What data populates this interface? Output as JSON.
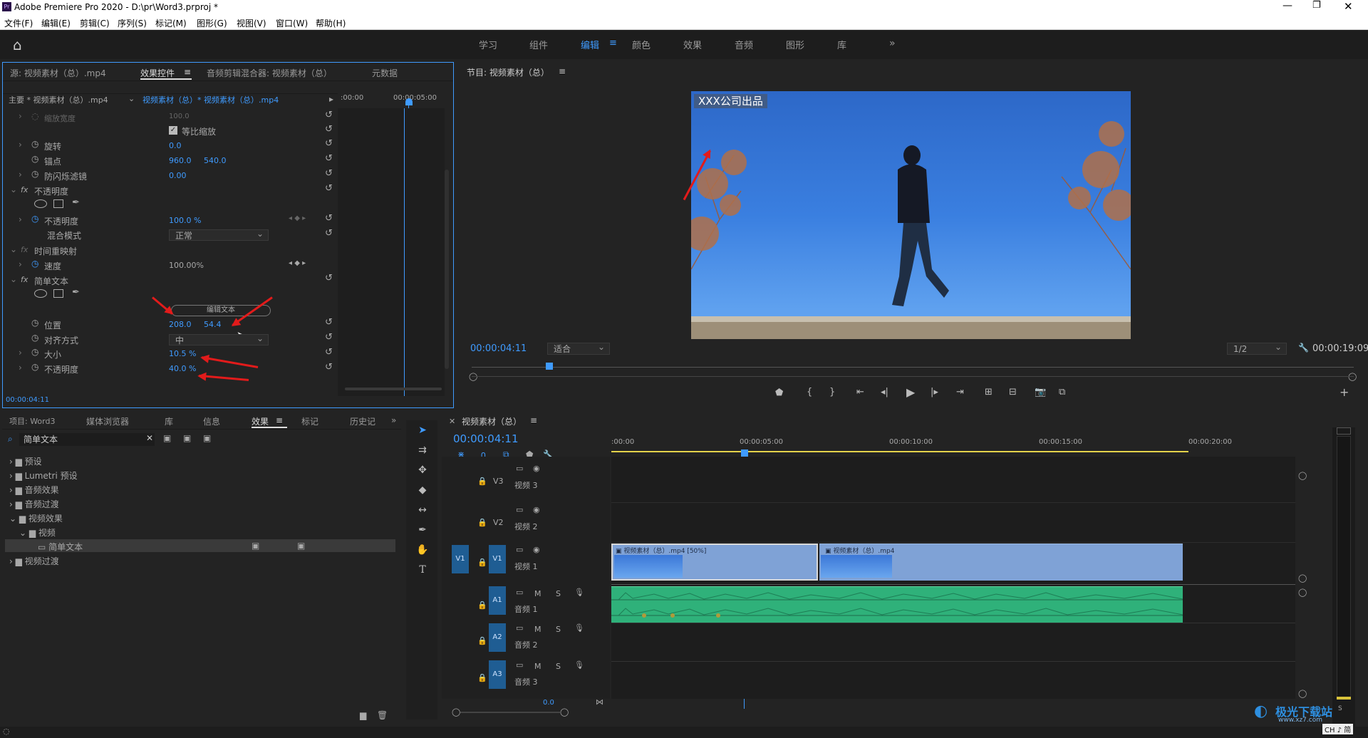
{
  "window": {
    "title": "Adobe Premiere Pro 2020 - D:\\pr\\Word3.prproj *",
    "app_icon": "Pr"
  },
  "menu": [
    "文件(F)",
    "编辑(E)",
    "剪辑(C)",
    "序列(S)",
    "标记(M)",
    "图形(G)",
    "视图(V)",
    "窗口(W)",
    "帮助(H)"
  ],
  "workspaces": [
    "学习",
    "组件",
    "编辑",
    "颜色",
    "效果",
    "音频",
    "图形",
    "库"
  ],
  "active_workspace": "编辑",
  "source_tabs": [
    "源: 视频素材（总）.mp4",
    "效果控件",
    "音频剪辑混合器: 视频素材（总）",
    "元数据"
  ],
  "effect_controls": {
    "master_label": "主要 * 视频素材（总）.mp4",
    "clip_label": "视频素材（总）* 视频素材（总）.mp4",
    "time0": ":00:00",
    "time1": "00:00:05:00",
    "rows": {
      "scale_width": {
        "label": "缩放宽度",
        "value": "100.0"
      },
      "uniform_scale": {
        "label": "等比缩放"
      },
      "rotation": {
        "label": "旋转",
        "value": "0.0"
      },
      "anchor": {
        "label": "锚点",
        "x": "960.0",
        "y": "540.0"
      },
      "antiflicker": {
        "label": "防闪烁滤镜",
        "value": "0.00"
      },
      "opacity_fx": {
        "label": "不透明度"
      },
      "opacity": {
        "label": "不透明度",
        "value": "100.0 %"
      },
      "blend": {
        "label": "混合模式",
        "value": "正常"
      },
      "timeremap": {
        "label": "时间重映射"
      },
      "speed": {
        "label": "速度",
        "value": "100.00%"
      },
      "simpletext": {
        "label": "简单文本"
      },
      "edit_text": "编辑文本",
      "position": {
        "label": "位置",
        "x": "208.0",
        "y": "54.4"
      },
      "align": {
        "label": "对齐方式",
        "value": "中"
      },
      "size": {
        "label": "大小",
        "value": "10.5 %"
      },
      "text_opacity": {
        "label": "不透明度",
        "value": "40.0 %"
      }
    },
    "timecode": "00:00:04:11"
  },
  "program": {
    "title": "节目: 视频素材（总）",
    "overlay_text": "XXX公司出品",
    "timecode": "00:00:04:11",
    "fit": "适合",
    "res": "1/2",
    "duration": "00:00:19:09"
  },
  "project_tabs": [
    "项目: Word3",
    "媒体浏览器",
    "库",
    "信息",
    "效果",
    "标记",
    "历史记"
  ],
  "search_value": "简单文本",
  "effects_tree": [
    "预设",
    "Lumetri 预设",
    "音频效果",
    "音频过渡",
    "视频效果",
    "视频",
    "简单文本",
    "视频过渡"
  ],
  "timeline": {
    "title": "视频素材（总）",
    "timecode": "00:00:04:11",
    "ruler": [
      ":00:00",
      "00:00:05:00",
      "00:00:10:00",
      "00:00:15:00",
      "00:00:20:00"
    ],
    "tracks": [
      {
        "id": "V3",
        "name": "视频 3"
      },
      {
        "id": "V2",
        "name": "视频 2"
      },
      {
        "id": "V1",
        "name": "视频 1",
        "src": "V1"
      },
      {
        "id": "A1",
        "name": "音频 1"
      },
      {
        "id": "A2",
        "name": "音频 2"
      },
      {
        "id": "A3",
        "name": "音频 3"
      }
    ],
    "clip1": "视频素材（总）.mp4 [50%]",
    "clip2": "视频素材（总）.mp4",
    "bottom_value": "0.0",
    "track_m": "M",
    "track_s": "S"
  },
  "watermark": {
    "text": "极光下载站",
    "sub": "www.xz7.com",
    "ime": "CH ♪ 简"
  },
  "colors": {
    "accent": "#3f9bff",
    "track_blue": "#1f5d93",
    "clip_video": "#7fa2d6",
    "clip_audio": "#2fb17a",
    "arrow": "#e21b1b"
  }
}
